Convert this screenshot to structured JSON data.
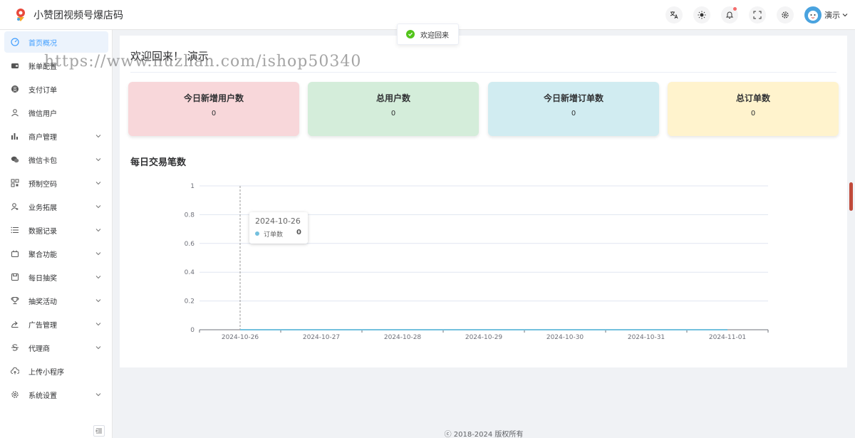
{
  "app": {
    "title": "小赞团视频号爆店码"
  },
  "header": {
    "user_name": "演示"
  },
  "toast": {
    "text": "欢迎回来"
  },
  "sidebar": {
    "items": [
      {
        "label": "首页概况",
        "icon": "dashboard-icon",
        "active": true,
        "has_submenu": false
      },
      {
        "label": "账单配置",
        "icon": "wallet-icon",
        "active": false,
        "has_submenu": false
      },
      {
        "label": "支付订单",
        "icon": "payment-icon",
        "active": false,
        "has_submenu": false
      },
      {
        "label": "微信用户",
        "icon": "user-icon",
        "active": false,
        "has_submenu": false
      },
      {
        "label": "商户管理",
        "icon": "bar-chart-icon",
        "active": false,
        "has_submenu": true
      },
      {
        "label": "微信卡包",
        "icon": "wechat-icon",
        "active": false,
        "has_submenu": true
      },
      {
        "label": "预制空码",
        "icon": "qrcode-icon",
        "active": false,
        "has_submenu": true
      },
      {
        "label": "业务拓展",
        "icon": "user-add-icon",
        "active": false,
        "has_submenu": true
      },
      {
        "label": "数据记录",
        "icon": "list-icon",
        "active": false,
        "has_submenu": true
      },
      {
        "label": "聚合功能",
        "icon": "plugin-icon",
        "active": false,
        "has_submenu": true
      },
      {
        "label": "每日抽奖",
        "icon": "save-icon",
        "active": false,
        "has_submenu": true
      },
      {
        "label": "抽奖活动",
        "icon": "trophy-icon",
        "active": false,
        "has_submenu": true
      },
      {
        "label": "广告管理",
        "icon": "share-icon",
        "active": false,
        "has_submenu": true
      },
      {
        "label": "代理商",
        "icon": "strikethrough-icon",
        "active": false,
        "has_submenu": true
      },
      {
        "label": "上传小程序",
        "icon": "cloud-upload-icon",
        "active": false,
        "has_submenu": false
      },
      {
        "label": "系统设置",
        "icon": "gear-icon",
        "active": false,
        "has_submenu": true
      }
    ]
  },
  "main": {
    "welcome": "欢迎回来！ 演示",
    "stats": [
      {
        "title": "今日新增用户数",
        "value": "0",
        "color": "#f8d7da"
      },
      {
        "title": "总用户数",
        "value": "0",
        "color": "#d4edda"
      },
      {
        "title": "今日新增订单数",
        "value": "0",
        "color": "#d1ecf1"
      },
      {
        "title": "总订单数",
        "value": "0",
        "color": "#fff3cd"
      }
    ],
    "section_title": "每日交易笔数"
  },
  "chart_data": {
    "type": "line",
    "title": "每日交易笔数",
    "categories": [
      "2024-10-26",
      "2024-10-27",
      "2024-10-28",
      "2024-10-29",
      "2024-10-30",
      "2024-10-31",
      "2024-11-01"
    ],
    "series": [
      {
        "name": "订单数",
        "values": [
          0,
          0,
          0,
          0,
          0,
          0,
          0
        ],
        "color": "#73c0de"
      }
    ],
    "ylim": [
      0,
      1
    ],
    "yticks": [
      "0",
      "0.2",
      "0.4",
      "0.6",
      "0.8",
      "1"
    ],
    "grid": true
  },
  "tooltip": {
    "date": "2024-10-26",
    "series": "订单数",
    "value": "0"
  },
  "footer": {
    "text": "ⓒ 2018-2024 版权所有"
  },
  "watermark": {
    "text": "https://www.huzhan.com/ishop50340"
  }
}
